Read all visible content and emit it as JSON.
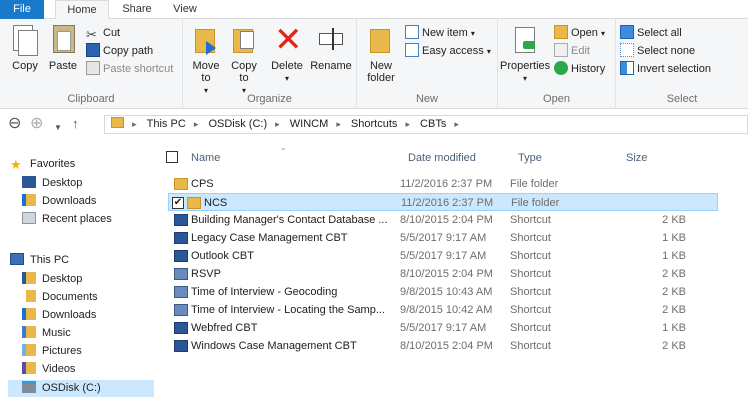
{
  "tabs": {
    "file": "File",
    "home": "Home",
    "share": "Share",
    "view": "View"
  },
  "ribbon": {
    "clipboard": {
      "label": "Clipboard",
      "copy": "Copy",
      "paste": "Paste",
      "cut": "Cut",
      "copy_path": "Copy path",
      "paste_shortcut": "Paste shortcut"
    },
    "organize": {
      "label": "Organize",
      "move_to": "Move to",
      "copy_to": "Copy to",
      "delete": "Delete",
      "rename": "Rename"
    },
    "new": {
      "label": "New",
      "new_folder": "New folder",
      "new_item": "New item",
      "easy_access": "Easy access"
    },
    "open": {
      "label": "Open",
      "properties": "Properties",
      "open": "Open",
      "edit": "Edit",
      "history": "History"
    },
    "select": {
      "label": "Select",
      "select_all": "Select all",
      "select_none": "Select none",
      "invert_selection": "Invert selection"
    }
  },
  "address": {
    "crumbs": [
      "This PC",
      "OSDisk (C:)",
      "WINCM",
      "Shortcuts",
      "CBTs"
    ]
  },
  "nav": {
    "favorites": "Favorites",
    "desktop": "Desktop",
    "downloads": "Downloads",
    "recent_places": "Recent places",
    "this_pc": "This PC",
    "pc_desktop": "Desktop",
    "documents": "Documents",
    "pc_downloads": "Downloads",
    "music": "Music",
    "pictures": "Pictures",
    "videos": "Videos",
    "osdisk": "OSDisk (C:)"
  },
  "columns": {
    "name": "Name",
    "date": "Date modified",
    "type": "Type",
    "size": "Size"
  },
  "files": [
    {
      "name": "CPS",
      "date": "11/2/2016 2:37 PM",
      "type": "File folder",
      "size": ""
    },
    {
      "name": "NCS",
      "date": "11/2/2016 2:37 PM",
      "type": "File folder",
      "size": ""
    },
    {
      "name": "Building Manager's Contact Database ...",
      "date": "8/10/2015 2:04 PM",
      "type": "Shortcut",
      "size": "2 KB"
    },
    {
      "name": "Legacy Case Management CBT",
      "date": "5/5/2017 9:17 AM",
      "type": "Shortcut",
      "size": "1 KB"
    },
    {
      "name": "Outlook CBT",
      "date": "5/5/2017 9:17 AM",
      "type": "Shortcut",
      "size": "1 KB"
    },
    {
      "name": "RSVP",
      "date": "8/10/2015 2:04 PM",
      "type": "Shortcut",
      "size": "2 KB"
    },
    {
      "name": "Time of Interview - Geocoding",
      "date": "9/8/2015 10:43 AM",
      "type": "Shortcut",
      "size": "2 KB"
    },
    {
      "name": "Time of Interview - Locating the Samp...",
      "date": "9/8/2015 10:42 AM",
      "type": "Shortcut",
      "size": "2 KB"
    },
    {
      "name": "Webfred CBT",
      "date": "5/5/2017 9:17 AM",
      "type": "Shortcut",
      "size": "1 KB"
    },
    {
      "name": "Windows Case Management CBT",
      "date": "8/10/2015 2:04 PM",
      "type": "Shortcut",
      "size": "2 KB"
    }
  ],
  "colors": {
    "accent": "#1979ca",
    "selection": "#cce8ff",
    "folder": "#e8b84a"
  }
}
